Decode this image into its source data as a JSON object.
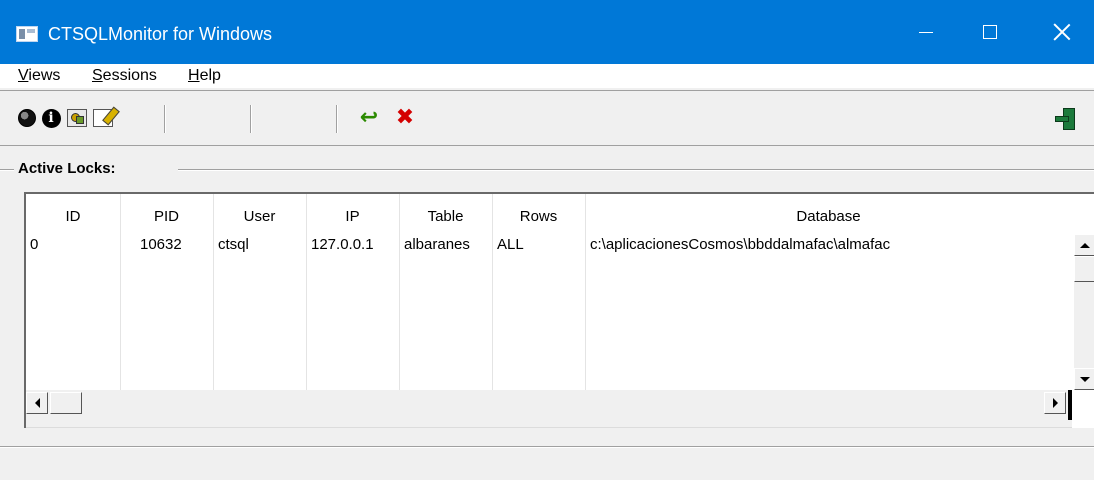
{
  "window": {
    "title": "CTSQLMonitor for Windows"
  },
  "menu": {
    "views": "Views",
    "sessions": "Sessions",
    "help": "Help"
  },
  "toolbar": {
    "icons": [
      "globe-icon",
      "info-icon",
      "sessions-icon",
      "edit-icon",
      "refresh-icon",
      "delete-icon",
      "exit-icon"
    ],
    "info_glyph": "i",
    "refresh_glyph": "↩",
    "delete_glyph": "✖"
  },
  "locks": {
    "group_label": "Active Locks:",
    "columns": [
      "ID",
      "PID",
      "User",
      "IP",
      "Table",
      "Rows",
      "Database"
    ],
    "rows": [
      {
        "id": "0",
        "pid": "10632",
        "user": "ctsql",
        "ip": "127.0.0.1",
        "table": "albaranes",
        "rows": "ALL",
        "database": "c:\\aplicacionesCosmos\\bbddalmafac\\almafac"
      }
    ]
  },
  "colors": {
    "titlebar": "#0078d7",
    "window_bg": "#f0f0f0",
    "list_bg": "#ffffff",
    "refresh_green": "#2b8a00",
    "delete_red": "#d40000"
  }
}
